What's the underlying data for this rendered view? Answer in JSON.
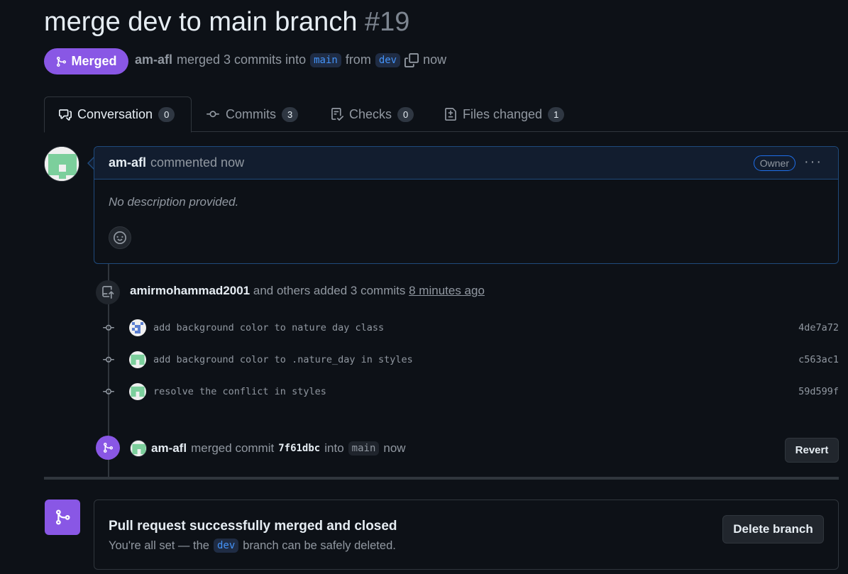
{
  "header": {
    "title": "merge dev to main branch",
    "number": "#19",
    "state": "Merged",
    "author": "am-afl",
    "action": "merged 3 commits into",
    "base_branch": "main",
    "from_text": "from",
    "head_branch": "dev",
    "time": "now"
  },
  "tabs": [
    {
      "label": "Conversation",
      "count": "0",
      "icon": "comment-discussion-icon"
    },
    {
      "label": "Commits",
      "count": "3",
      "icon": "git-commit-icon"
    },
    {
      "label": "Checks",
      "count": "0",
      "icon": "checklist-icon"
    },
    {
      "label": "Files changed",
      "count": "1",
      "icon": "file-diff-icon"
    }
  ],
  "comment": {
    "author": "am-afl",
    "action": "commented now",
    "badge": "Owner",
    "body": "No description provided.",
    "menu": "···"
  },
  "commits_event": {
    "author": "amirmohammad2001",
    "text": "and others added 3 commits",
    "time": "8 minutes ago"
  },
  "commits": [
    {
      "message": "add background color to nature day class",
      "sha": "4de7a72"
    },
    {
      "message": "add background color to .nature_day in styles",
      "sha": "c563ac1"
    },
    {
      "message": "resolve the conflict in styles",
      "sha": "59d599f"
    }
  ],
  "merge_event": {
    "author": "am-afl",
    "text": "merged commit",
    "commit": "7f61dbc",
    "into": "into",
    "branch": "main",
    "time": "now",
    "revert_label": "Revert"
  },
  "merge_box": {
    "title": "Pull request successfully merged and closed",
    "sub_before": "You're all set — the",
    "branch": "dev",
    "sub_after": "branch can be safely deleted.",
    "delete_label": "Delete branch"
  },
  "colors": {
    "merged_purple": "#8957e5",
    "link_blue": "#4493f8",
    "background": "#0d1117"
  }
}
